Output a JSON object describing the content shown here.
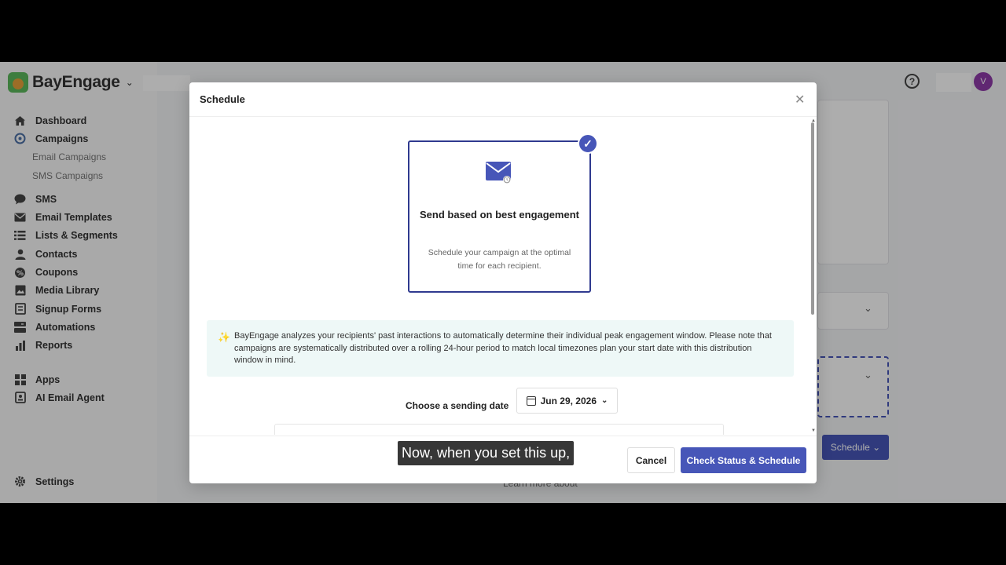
{
  "app": {
    "brand": "BayEngage",
    "avatar_initial": "V"
  },
  "sidebar": {
    "items": [
      {
        "label": "Dashboard",
        "icon": "home-icon"
      },
      {
        "label": "Campaigns",
        "icon": "campaigns-icon"
      },
      {
        "label": "Email Campaigns",
        "sub": true
      },
      {
        "label": "SMS Campaigns",
        "sub": true
      },
      {
        "label": "SMS",
        "icon": "sms-icon"
      },
      {
        "label": "Email Templates",
        "icon": "mail-icon"
      },
      {
        "label": "Lists & Segments",
        "icon": "list-icon"
      },
      {
        "label": "Contacts",
        "icon": "user-icon"
      },
      {
        "label": "Coupons",
        "icon": "coupon-icon"
      },
      {
        "label": "Media Library",
        "icon": "image-icon"
      },
      {
        "label": "Signup Forms",
        "icon": "form-icon"
      },
      {
        "label": "Automations",
        "icon": "automation-icon"
      },
      {
        "label": "Reports",
        "icon": "chart-icon"
      },
      {
        "label": "Apps",
        "icon": "apps-icon"
      },
      {
        "label": "AI Email Agent",
        "icon": "ai-agent-icon"
      }
    ],
    "settings_label": "Settings"
  },
  "background": {
    "schedule_button": "Schedule",
    "learn_more": "Learn more about"
  },
  "modal": {
    "title": "Schedule",
    "option": {
      "title": "Send based on best engagement",
      "description": "Schedule your campaign at the optimal time for each recipient."
    },
    "info_text": "BayEngage analyzes your recipients' past interactions to automatically determine their individual peak engagement window. Please note that campaigns are systematically distributed over a rolling 24-hour period to match local timezones plan your start date with this distribution window in mind.",
    "date_label": "Choose a sending date",
    "date_value": "Jun 29, 2026",
    "cancel_label": "Cancel",
    "primary_label": "Check Status & Schedule"
  },
  "caption": "Now, when you set this up,",
  "colors": {
    "primary": "#4756b8",
    "chat": "#2ec06a",
    "info_bg": "#eef8f7"
  }
}
